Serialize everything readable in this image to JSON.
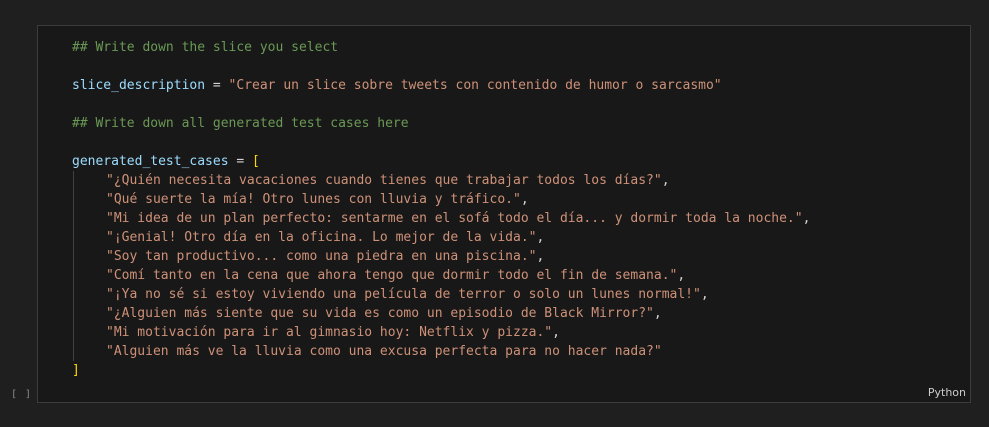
{
  "cell": {
    "execution_count": "[ ]",
    "language": "Python",
    "code": {
      "comment1": "## Write down the slice you select",
      "slice_var": "slice_description",
      "assign_op": " = ",
      "slice_value": "\"Crear un slice sobre tweets con contenido de humor o sarcasmo\"",
      "comment2": "## Write down all generated test cases here",
      "cases_var": "generated_test_cases",
      "open_bracket": "[",
      "close_bracket": "]",
      "comma": ",",
      "test_cases": [
        "\"¿Quién necesita vacaciones cuando tienes que trabajar todos los días?\"",
        "\"Qué suerte la mía! Otro lunes con lluvia y tráfico.\"",
        "\"Mi idea de un plan perfecto: sentarme en el sofá todo el día... y dormir toda la noche.\"",
        "\"¡Genial! Otro día en la oficina. Lo mejor de la vida.\"",
        "\"Soy tan productivo... como una piedra en una piscina.\"",
        "\"Comí tanto en la cena que ahora tengo que dormir todo el fin de semana.\"",
        "\"¡Ya no sé si estoy viviendo una película de terror o solo un lunes normal!\"",
        "\"¿Alguien más siente que su vida es como un episodio de Black Mirror?\"",
        "\"Mi motivación para ir al gimnasio hoy: Netflix y pizza.\"",
        "\"Alguien más ve la lluvia como una excusa perfecta para no hacer nada?\""
      ]
    }
  }
}
